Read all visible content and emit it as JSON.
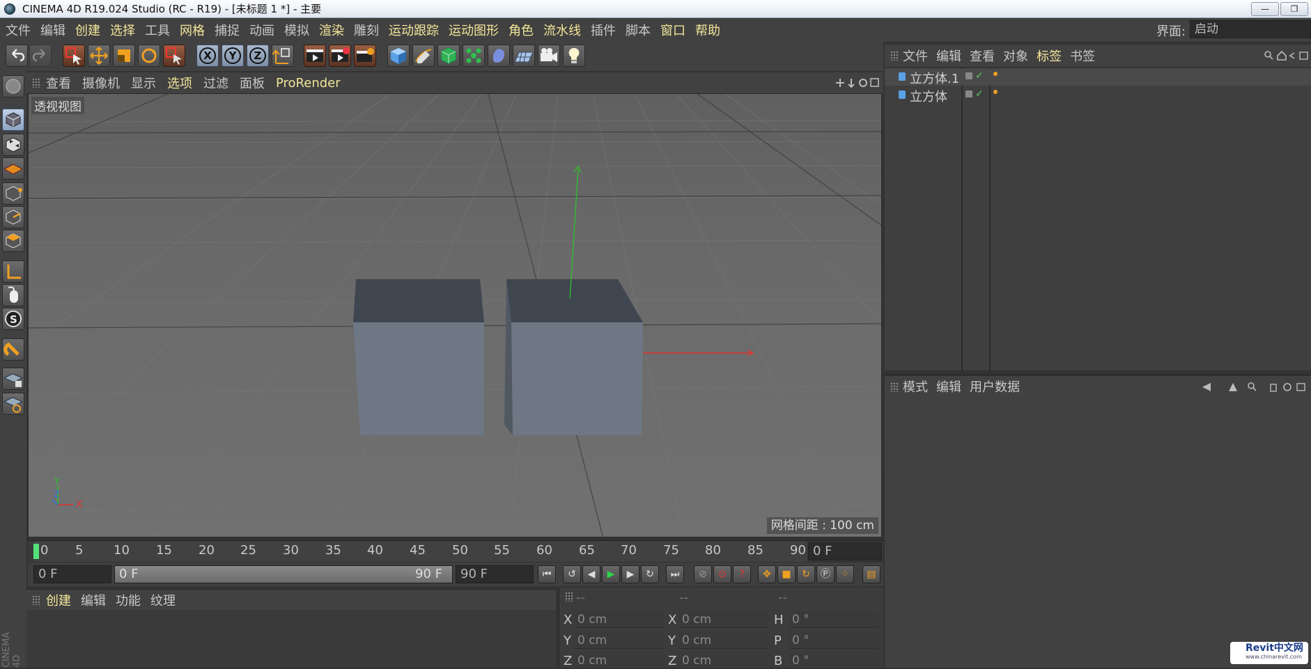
{
  "window": {
    "title": "CINEMA 4D R19.024 Studio (RC - R19) - [未标题 1 *] - 主要",
    "minimize_label": "—",
    "restore_label": "❐"
  },
  "menubar": {
    "items": [
      "文件",
      "编辑",
      "创建",
      "选择",
      "工具",
      "网格",
      "捕捉",
      "动画",
      "模拟",
      "渲染",
      "雕刻",
      "运动跟踪",
      "运动图形",
      "角色",
      "流水线",
      "插件",
      "脚本",
      "窗口",
      "帮助"
    ],
    "highlighted": [
      "创建",
      "选择",
      "网格",
      "渲染",
      "运动跟踪",
      "运动图形",
      "角色",
      "流水线",
      "窗口",
      "帮助"
    ],
    "interface_label": "界面:",
    "interface_value": "启动"
  },
  "toolbar": {
    "axis_x": "X",
    "axis_y": "Y",
    "axis_z": "Z",
    "icons": [
      "undo-icon",
      "redo-icon",
      "live-selection-icon",
      "move-icon",
      "scale-icon",
      "rotate-icon",
      "recent-tools-icon",
      "x-axis-icon",
      "y-axis-icon",
      "z-axis-icon",
      "coordinate-system-icon",
      "render-view-icon",
      "render-to-picture-viewer-icon",
      "render-settings-icon",
      "cube-object-icon",
      "pen-spline-icon",
      "subdivision-surface-icon",
      "cloner-icon",
      "deformer-icon",
      "floor-icon",
      "camera-icon",
      "light-icon"
    ]
  },
  "viewport": {
    "menu": [
      "查看",
      "摄像机",
      "显示",
      "选项",
      "过滤",
      "面板",
      "ProRender"
    ],
    "highlighted": [
      "选项",
      "ProRender"
    ],
    "view_label": "透视视图",
    "grid_spacing": "网格间距 : 100 cm",
    "axis_labels": {
      "y": "Y",
      "z": "Z",
      "x": "X"
    }
  },
  "timeline": {
    "ticks": [
      "0",
      "5",
      "10",
      "15",
      "20",
      "25",
      "30",
      "35",
      "40",
      "45",
      "50",
      "55",
      "60",
      "65",
      "70",
      "75",
      "80",
      "85",
      "90"
    ],
    "current_frame": "0 F",
    "start_field": "0 F",
    "range_start": "0 F",
    "range_end": "90 F",
    "end_field": "90 F"
  },
  "material_manager": {
    "menu": [
      "创建",
      "编辑",
      "功能",
      "纹理"
    ],
    "highlighted": [
      "创建"
    ]
  },
  "coordinates": {
    "headers": [
      "--",
      "--",
      "--"
    ],
    "rows": [
      {
        "l1": "X",
        "v1": "0 cm",
        "l2": "X",
        "v2": "0 cm",
        "l3": "H",
        "v3": "0 °"
      },
      {
        "l1": "Y",
        "v1": "0 cm",
        "l2": "Y",
        "v2": "0 cm",
        "l3": "P",
        "v3": "0 °"
      },
      {
        "l1": "Z",
        "v1": "0 cm",
        "l2": "Z",
        "v2": "0 cm",
        "l3": "B",
        "v3": "0 °"
      }
    ]
  },
  "object_manager": {
    "menu": [
      "文件",
      "编辑",
      "查看",
      "对象",
      "标签",
      "书签"
    ],
    "highlighted": [
      "标签"
    ],
    "objects": [
      "立方体.1",
      "立方体"
    ]
  },
  "attribute_manager": {
    "menu": [
      "模式",
      "编辑",
      "用户数据"
    ]
  },
  "watermark": {
    "text": "Revit中文网",
    "url": "www.chinarevit.com"
  },
  "side_logo": "CINEMA 4D",
  "colors": {
    "accent_menu": "#f2e59a",
    "panel_bg": "#414141",
    "axis_x": "#e03030",
    "axis_y": "#2fbf2f",
    "axis_z": "#3070e0"
  }
}
